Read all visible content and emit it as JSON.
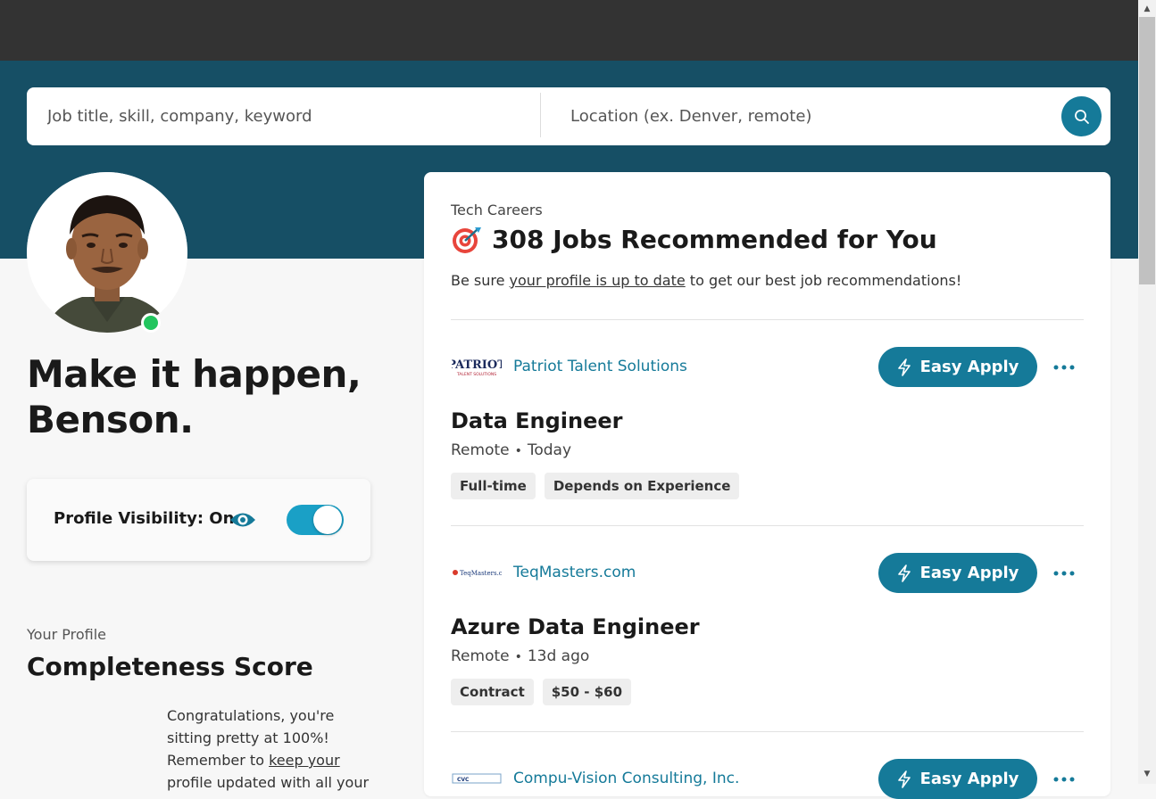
{
  "search": {
    "keyword_placeholder": "Job title, skill, company, keyword",
    "location_placeholder": "Location (ex. Denver, remote)"
  },
  "profile": {
    "greeting": "Make it happen, Benson.",
    "visibility_label": "Profile Visibility: On",
    "visibility_on": true,
    "status": "online",
    "completeness_kicker": "Your Profile",
    "completeness_title": "Completeness Score",
    "completeness_text_before": "Congratulations, you're sitting pretty at 100%! Remember to ",
    "completeness_link": "keep your",
    "completeness_text_after": " profile updated with all your",
    "completeness_score": 100
  },
  "recommendations": {
    "kicker": "Tech Careers",
    "icon": "target-icon",
    "title": "308 Jobs Recommended for You",
    "sub_before": "Be sure ",
    "sub_link": "your profile is up to date",
    "sub_after": " to get our best job recommendations!"
  },
  "jobs": [
    {
      "company": "Patriot Talent Solutions",
      "logo_text": "PATRIOT",
      "logo_subtext": "TALENT SOLUTIONS",
      "apply_label": "Easy Apply",
      "title": "Data Engineer",
      "location": "Remote",
      "posted": "Today",
      "tags": [
        "Full-time",
        "Depends on Experience"
      ]
    },
    {
      "company": "TeqMasters.com",
      "logo_text": "TeqMasters.com",
      "apply_label": "Easy Apply",
      "title": "Azure Data Engineer",
      "location": "Remote",
      "posted": "13d ago",
      "tags": [
        "Contract",
        "$50 - $60"
      ]
    },
    {
      "company": "Compu-Vision Consulting, Inc.",
      "logo_text": "CVC",
      "apply_label": "Easy Apply"
    }
  ],
  "colors": {
    "accent": "#157a99",
    "banner": "#164f65",
    "toggle_on": "#1aa0c6",
    "status_online": "#22c55e"
  }
}
